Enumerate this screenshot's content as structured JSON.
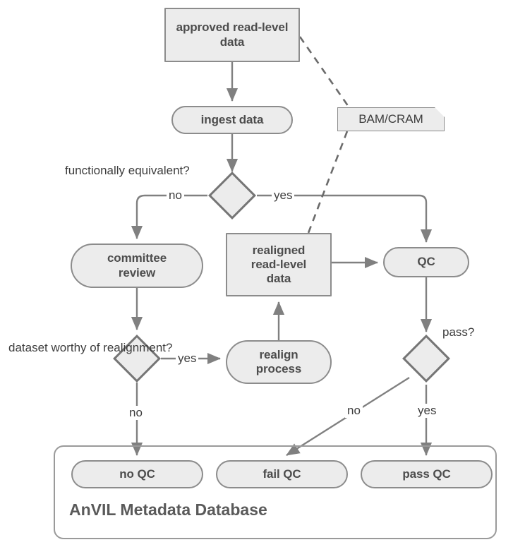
{
  "diagram": {
    "title": "AnVIL read-level data QC flow",
    "colors": {
      "node_fill": "#ececec",
      "node_stroke": "#8c8c8c",
      "diamond_stroke": "#757575",
      "edge_stroke": "#707070",
      "text": "#4d4d4d",
      "cluster_stroke": "#9a9a9a",
      "background": "#ffffff"
    },
    "nodes": {
      "approved_data": "approved read-level data",
      "ingest": "ingest data",
      "committee_review": "committee review",
      "realigned_data": "realigned read-level data",
      "realign_process": "realign process",
      "qc": "QC",
      "no_qc": "no QC",
      "fail_qc": "fail QC",
      "pass_qc": "pass QC"
    },
    "note": {
      "bam_cram": "BAM/CRAM"
    },
    "decisions": {
      "functionally_equivalent": "functionally equivalent?",
      "dataset_worthy": "dataset worthy of realignment?",
      "pass": "pass?"
    },
    "edge_labels": {
      "fe_no": "no",
      "fe_yes": "yes",
      "worthy_yes": "yes",
      "worthy_no": "no",
      "pass_no": "no",
      "pass_yes": "yes"
    },
    "cluster": {
      "anvil_db": "AnVIL Metadata Database"
    }
  }
}
